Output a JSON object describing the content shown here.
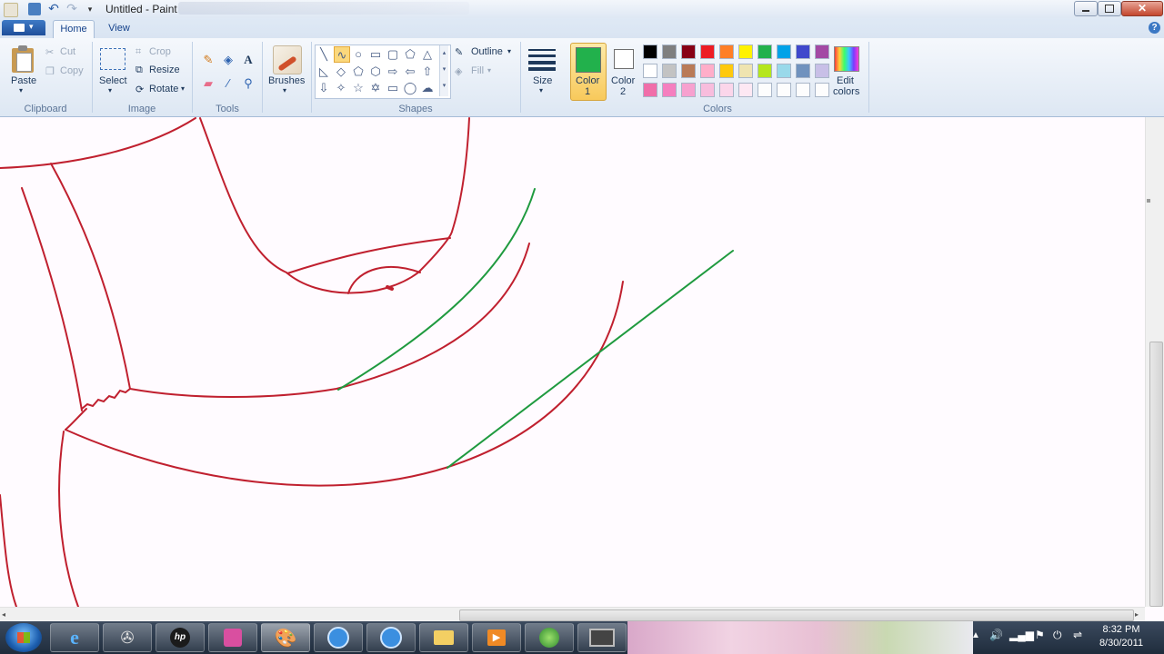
{
  "window": {
    "title": "Untitled - Paint"
  },
  "tabs": [
    {
      "label": "Home"
    },
    {
      "label": "View"
    }
  ],
  "clipboard": {
    "paste": "Paste",
    "cut": "Cut",
    "copy": "Copy",
    "group": "Clipboard"
  },
  "image": {
    "select": "Select",
    "crop": "Crop",
    "resize": "Resize",
    "rotate": "Rotate",
    "group": "Image"
  },
  "tools": {
    "group": "Tools"
  },
  "shapes": {
    "outline": "Outline",
    "fill": "Fill",
    "group": "Shapes"
  },
  "brushes": {
    "label": "Brushes"
  },
  "size": {
    "label": "Size"
  },
  "colors": {
    "color1": "Color",
    "color1_num": "1",
    "color2": "Color",
    "color2_num": "2",
    "edit": "Edit",
    "edit2": "colors",
    "group": "Colors",
    "color1_value": "#22b14c",
    "color2_value": "#ffffff",
    "palette_row1": [
      "#000000",
      "#7f7f7f",
      "#880015",
      "#ed1c24",
      "#ff7f27",
      "#fff200",
      "#22b14c",
      "#00a2e8",
      "#3f48cc",
      "#a349a4"
    ],
    "palette_row2": [
      "#ffffff",
      "#c3c3c3",
      "#b97a57",
      "#ffaec9",
      "#ffc90e",
      "#efe4b0",
      "#b5e61d",
      "#99d9ea",
      "#7092be",
      "#c8bfe7"
    ],
    "palette_row3": [
      "#f06ea9",
      "#f57fbf",
      "#f7a1cf",
      "#f8bddd",
      "#fbd6ea",
      "#fde8f3",
      "#fdfdfd",
      "#fdfdfd",
      "#fdfdfd",
      "#fdfdfd"
    ]
  },
  "taskbar": {
    "time": "8:32 PM",
    "date": "8/30/2011",
    "items": [
      "start-orb",
      "internet-explorer",
      "media-center",
      "hp",
      "onenote",
      "paint",
      "app-blue-1",
      "app-blue-2",
      "explorer",
      "media-player",
      "game",
      "remote-desktop"
    ]
  }
}
